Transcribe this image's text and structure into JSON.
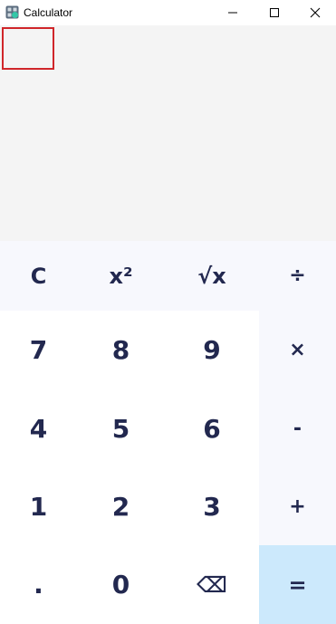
{
  "window": {
    "title": "Calculator",
    "app_icon": "calculator-app-icon",
    "controls": {
      "minimize": "minimize-icon",
      "maximize": "maximize-icon",
      "close": "close-icon"
    }
  },
  "display": {
    "value": ""
  },
  "keypad": {
    "top_row": {
      "clear": "C",
      "square": "x²",
      "sqrt": "√x",
      "divide": "÷"
    },
    "row1": {
      "k7": "7",
      "k8": "8",
      "k9": "9",
      "multiply": "×"
    },
    "row2": {
      "k4": "4",
      "k5": "5",
      "k6": "6",
      "subtract": "-"
    },
    "row3": {
      "k1": "1",
      "k2": "2",
      "k3": "3",
      "add": "+"
    },
    "row4": {
      "decimal": ".",
      "k0": "0",
      "backspace": "⌫",
      "equals": "="
    }
  },
  "colors": {
    "text": "#22284f",
    "display_bg": "#f4f4f4",
    "operator_bg": "#f7f8fd",
    "equals_bg": "#cce9fc",
    "focus_border": "#d0262a"
  }
}
